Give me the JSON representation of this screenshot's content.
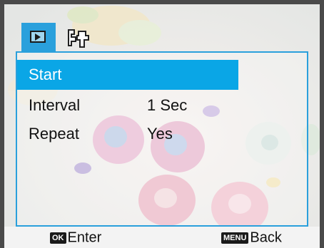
{
  "tabs": [
    {
      "name": "playback",
      "icon": "playback-icon",
      "active": true
    },
    {
      "name": "setup",
      "icon": "wrench-icon",
      "active": false
    }
  ],
  "menu": {
    "items": [
      {
        "label": "Start",
        "value": "",
        "selected": true
      },
      {
        "label": "Interval",
        "value": "1 Sec",
        "selected": false
      },
      {
        "label": "Repeat",
        "value": "Yes",
        "selected": false
      }
    ]
  },
  "footer": {
    "ok_key": "OK",
    "ok_label": "Enter",
    "menu_key": "MENU",
    "menu_label": "Back"
  },
  "colors": {
    "accent": "#0aa6e6",
    "frame": "#4a4a4a"
  }
}
